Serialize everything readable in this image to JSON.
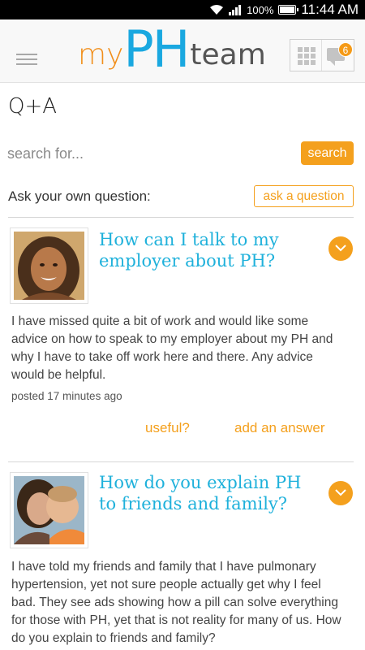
{
  "status_bar": {
    "battery": "100%",
    "time": "11:44 AM"
  },
  "header": {
    "logo": {
      "part1": "my",
      "part2": "PH",
      "part3": "team"
    },
    "notification_count": "6",
    "colors": {
      "brand_orange": "#f18e1a",
      "brand_blue": "#1aa8e0"
    }
  },
  "page": {
    "title": "Q+A"
  },
  "search": {
    "placeholder": "search for...",
    "button_label": "search"
  },
  "ask": {
    "label": "Ask your own question:",
    "button_label": "ask a question"
  },
  "questions": [
    {
      "title": "How can I talk to my employer about PH?",
      "body": "I have missed quite a bit of work and would like some advice on how to speak to my employer about my PH and why I have to take off work here and there. Any advice would be helpful.",
      "meta": "posted 17 minutes ago",
      "useful_label": "useful?",
      "answer_label": "add an answer"
    },
    {
      "title": "How do you explain PH to friends and family?",
      "body": "I have told my friends and family that I have pulmonary hypertension, yet not sure people actually get why I feel bad.  They see ads showing how a pill can solve everything for those with PH, yet that is not reality for many of us.  How do you explain to friends and family?"
    }
  ]
}
